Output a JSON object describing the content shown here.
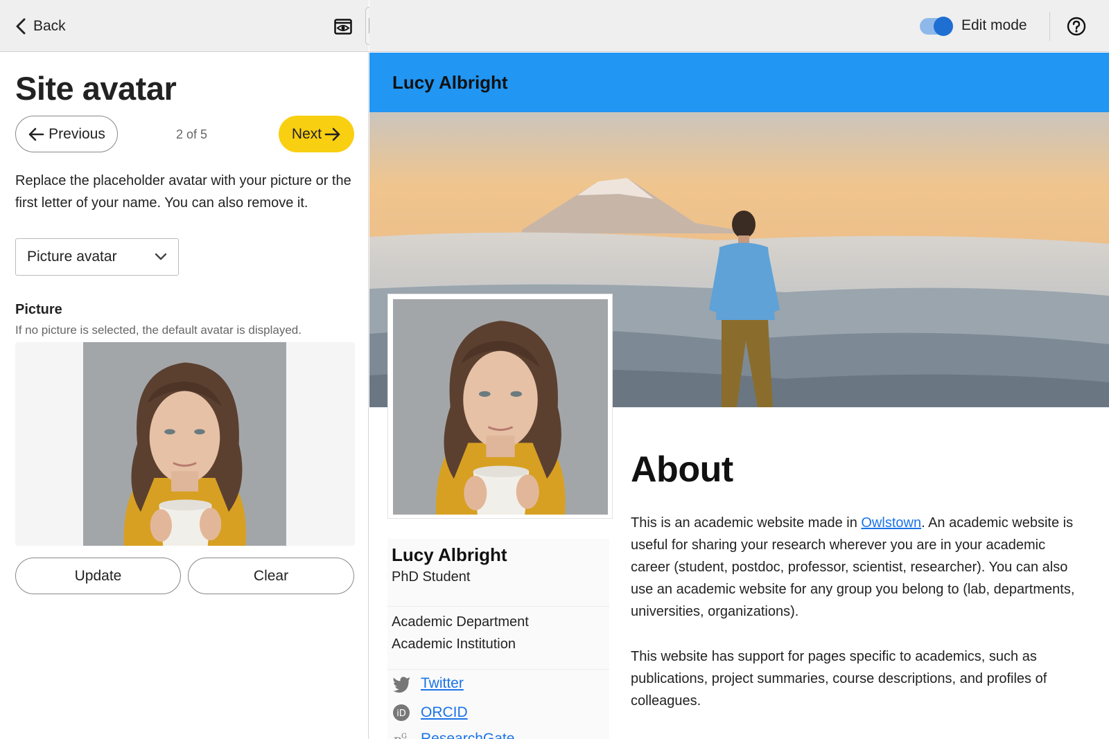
{
  "editor": {
    "back_label": "Back",
    "title": "Site avatar",
    "previous_label": "Previous",
    "step": "2 of 5",
    "next_label": "Next",
    "description": "Replace the placeholder avatar with your picture or the first letter of your name. You can also remove it.",
    "avatar_type_selected": "Picture avatar",
    "picture_label": "Picture",
    "picture_help": "If no picture is selected, the default avatar is displayed.",
    "update_label": "Update",
    "clear_label": "Clear"
  },
  "topbar": {
    "edit_mode_label": "Edit mode",
    "edit_mode_on": true
  },
  "site": {
    "name": "Lucy Albright",
    "header_color": "#2196f3",
    "profile": {
      "name": "Lucy Albright",
      "role": "PhD Student",
      "department": "Academic Department",
      "institution": "Academic Institution",
      "links": [
        {
          "label": "Twitter",
          "icon": "twitter-icon"
        },
        {
          "label": "ORCID",
          "icon": "orcid-icon"
        },
        {
          "label": "ResearchGate",
          "icon": "researchgate-icon"
        }
      ]
    },
    "about": {
      "title": "About",
      "p1_before": "This is an academic website made in ",
      "p1_link": "Owlstown",
      "p1_after": ". An academic website is useful for sharing your research wherever you are in your academic career (student, postdoc, professor, scientist, researcher). You can also use an academic website for any group you belong to (lab, departments, universities, organizations).",
      "p2": "This website has support for pages specific to academics, such as publications, project summaries, course descriptions, and profiles of colleagues."
    }
  },
  "colors": {
    "next_button": "#f9cf11",
    "link": "#1a73e8",
    "toggle_knob": "#1f6fd2"
  }
}
